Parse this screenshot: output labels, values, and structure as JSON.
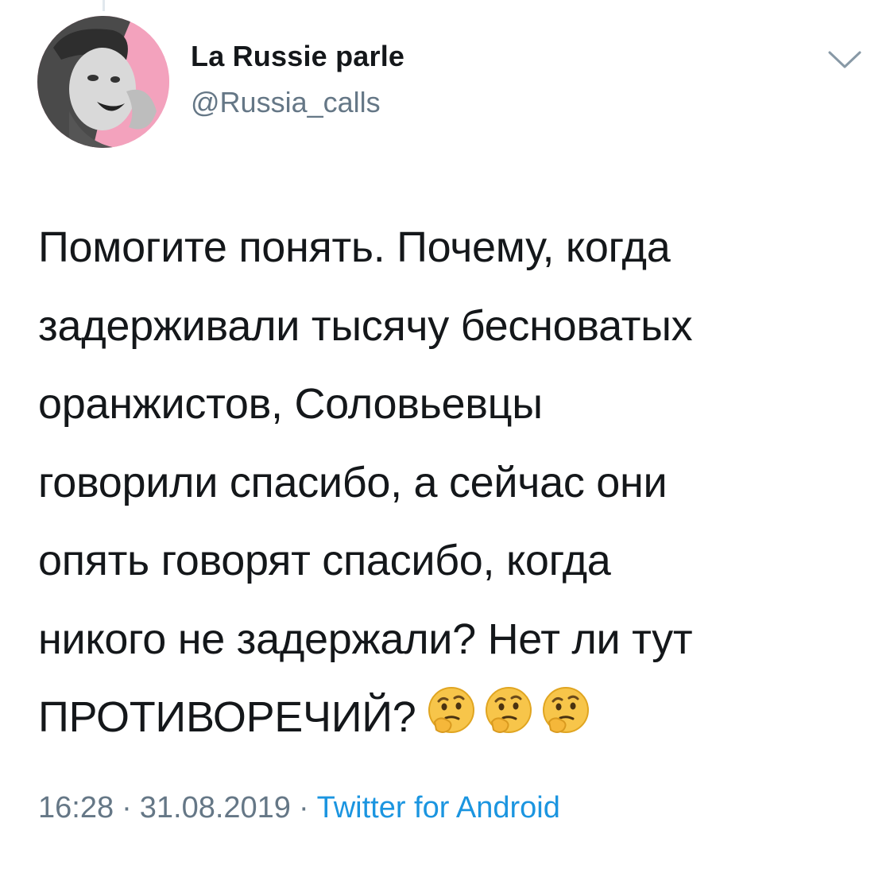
{
  "user": {
    "display_name": "La Russie parle",
    "handle": "@Russia_calls",
    "avatar": "avatar-photo"
  },
  "header": {
    "menu_icon": "chevron-down-icon"
  },
  "tweet": {
    "lines": [
      "Помогите понять. Почему, когда",
      "задерживали тысячу бесноватых",
      "оранжистов, Соловьевцы",
      "говорили спасибо, а сейчас они",
      "опять говорят спасибо, когда",
      "никого не задержали? Нет ли тут",
      "ПРОТИВОРЕЧИЙ?"
    ],
    "emojis": [
      "thinking-face-icon",
      "thinking-face-icon",
      "thinking-face-icon"
    ]
  },
  "meta": {
    "time": "16:28",
    "separator": "·",
    "date": "31.08.2019",
    "source": "Twitter for Android"
  },
  "colors": {
    "text": "#14171a",
    "secondary": "#657786",
    "link": "#1b95e0",
    "emoji_face": "#f7c54a"
  }
}
